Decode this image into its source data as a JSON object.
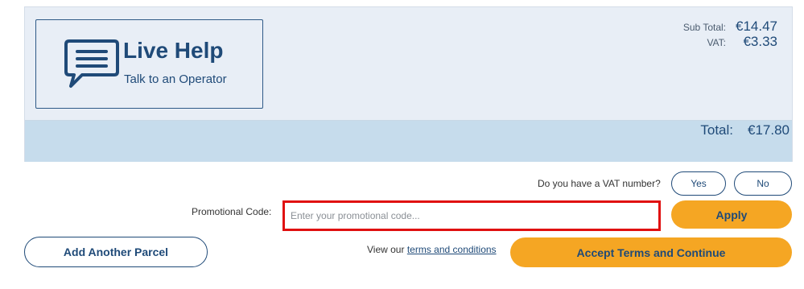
{
  "live_help": {
    "title": "Live Help",
    "subtitle": "Talk to an Operator",
    "icon": "chat-bubble-icon"
  },
  "summary": {
    "subtotal_label": "Sub Total:",
    "subtotal_value": "€14.47",
    "vat_label": "VAT:",
    "vat_value": "€3.33",
    "total_label": "Total:",
    "total_value": "€17.80"
  },
  "vat_question": {
    "text": "Do you have a VAT number?",
    "yes_label": "Yes",
    "no_label": "No"
  },
  "promo": {
    "label": "Promotional Code:",
    "placeholder": "Enter your promotional code...",
    "value": "",
    "apply_label": "Apply"
  },
  "actions": {
    "add_parcel_label": "Add Another Parcel",
    "terms_prefix": "View our",
    "terms_link": "terms and conditions",
    "accept_label": "Accept Terms and Continue"
  },
  "colors": {
    "navy": "#1f4a78",
    "orange": "#f5a623",
    "panel": "#e8eef6",
    "total_bar": "#c6dcec",
    "highlight": "#e01010"
  }
}
